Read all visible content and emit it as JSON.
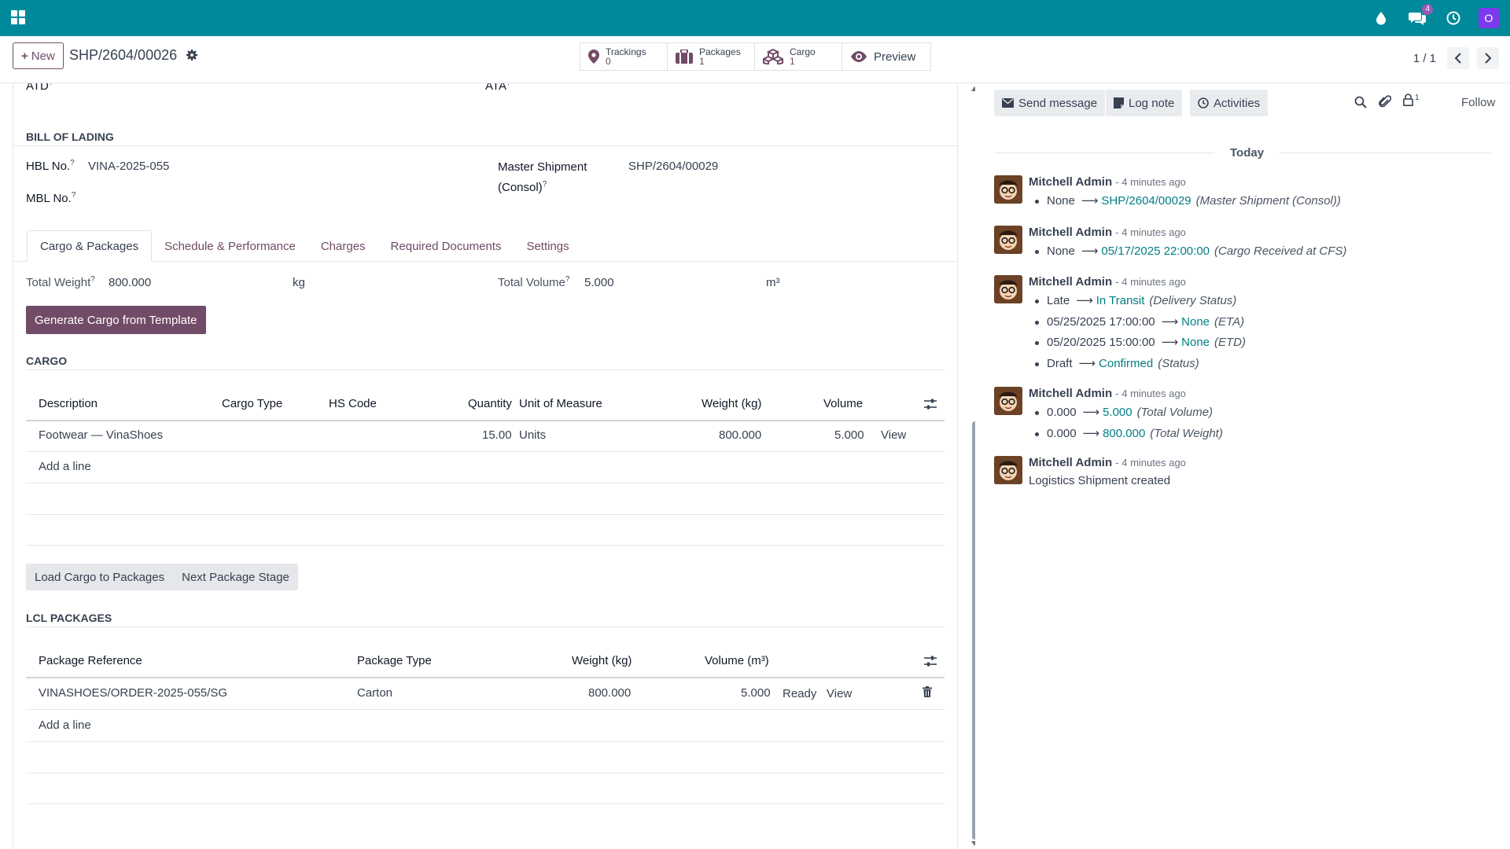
{
  "topbar": {
    "chat_badge": "4",
    "avatar_letter": "O",
    "accent": "#00899a"
  },
  "control": {
    "new_label": "New",
    "record_name": "SHP/2604/00026",
    "smart_buttons": [
      {
        "label": "Trackings",
        "value": "0"
      },
      {
        "label": "Packages",
        "value": "1"
      },
      {
        "label": "Cargo",
        "value": "1"
      }
    ],
    "preview_label": "Preview",
    "pager": "1 / 1"
  },
  "form": {
    "atd_label": "ATD",
    "ata_label": "ATA",
    "bol_title": "BILL OF LADING",
    "hbl_label": "HBL No.",
    "hbl_value": "VINA-2025-055",
    "mbl_label": "MBL No.",
    "master_label_1": "Master Shipment",
    "master_label_2": "(Consol)",
    "master_value": "SHP/2604/00029",
    "help_mark": "?",
    "tabs": [
      "Cargo & Packages",
      "Schedule & Performance",
      "Charges",
      "Required Documents",
      "Settings"
    ],
    "total_weight_label": "Total Weight",
    "total_weight_value": "800.000",
    "weight_unit": "kg",
    "total_volume_label": "Total Volume",
    "total_volume_value": "5.000",
    "volume_unit": "m³",
    "generate_btn": "Generate Cargo from Template",
    "cargo_title": "CARGO",
    "cargo_headers": [
      "Description",
      "Cargo Type",
      "HS Code",
      "Quantity",
      "Unit of Measure",
      "Weight (kg)",
      "Volume"
    ],
    "cargo_row": {
      "description": "Footwear — VinaShoes",
      "quantity": "15.00",
      "uom": "Units",
      "weight": "800.000",
      "volume": "5.000",
      "view": "View"
    },
    "add_line": "Add a line",
    "load_cargo_btn": "Load Cargo to Packages",
    "next_stage_btn": "Next Package Stage",
    "lcl_title": "LCL PACKAGES",
    "pkg_headers": [
      "Package Reference",
      "Package Type",
      "Weight (kg)",
      "Volume (m³)"
    ],
    "pkg_row": {
      "reference": "VINASHOES/ORDER-2025-055/SG",
      "type": "Carton",
      "weight": "800.000",
      "volume": "5.000",
      "state": "Ready",
      "view": "View"
    }
  },
  "chatter": {
    "send_message": "Send message",
    "log_note": "Log note",
    "activities": "Activities",
    "followers_count": "1",
    "follow": "Follow",
    "today": "Today",
    "messages": [
      {
        "author": "Mitchell Admin",
        "time": "- 4 minutes ago",
        "lines": [
          {
            "old": "None",
            "new": "SHP/2604/00029",
            "field": "(Master Shipment (Consol))"
          }
        ]
      },
      {
        "author": "Mitchell Admin",
        "time": "- 4 minutes ago",
        "lines": [
          {
            "old": "None",
            "new": "05/17/2025 22:00:00",
            "field": "(Cargo Received at CFS)"
          }
        ]
      },
      {
        "author": "Mitchell Admin",
        "time": "- 4 minutes ago",
        "lines": [
          {
            "old": "Late",
            "new": "In Transit",
            "field": "(Delivery Status)"
          },
          {
            "old": "05/25/2025 17:00:00",
            "new": "None",
            "field": "(ETA)"
          },
          {
            "old": "05/20/2025 15:00:00",
            "new": "None",
            "field": "(ETD)"
          },
          {
            "old": "Draft",
            "new": "Confirmed",
            "field": "(Status)"
          }
        ]
      },
      {
        "author": "Mitchell Admin",
        "time": "- 4 minutes ago",
        "lines": [
          {
            "old": "0.000",
            "new": "5.000",
            "field": "(Total Volume)"
          },
          {
            "old": "0.000",
            "new": "800.000",
            "field": "(Total Weight)"
          }
        ]
      },
      {
        "author": "Mitchell Admin",
        "time": "- 4 minutes ago",
        "body": "Logistics Shipment created"
      }
    ]
  }
}
